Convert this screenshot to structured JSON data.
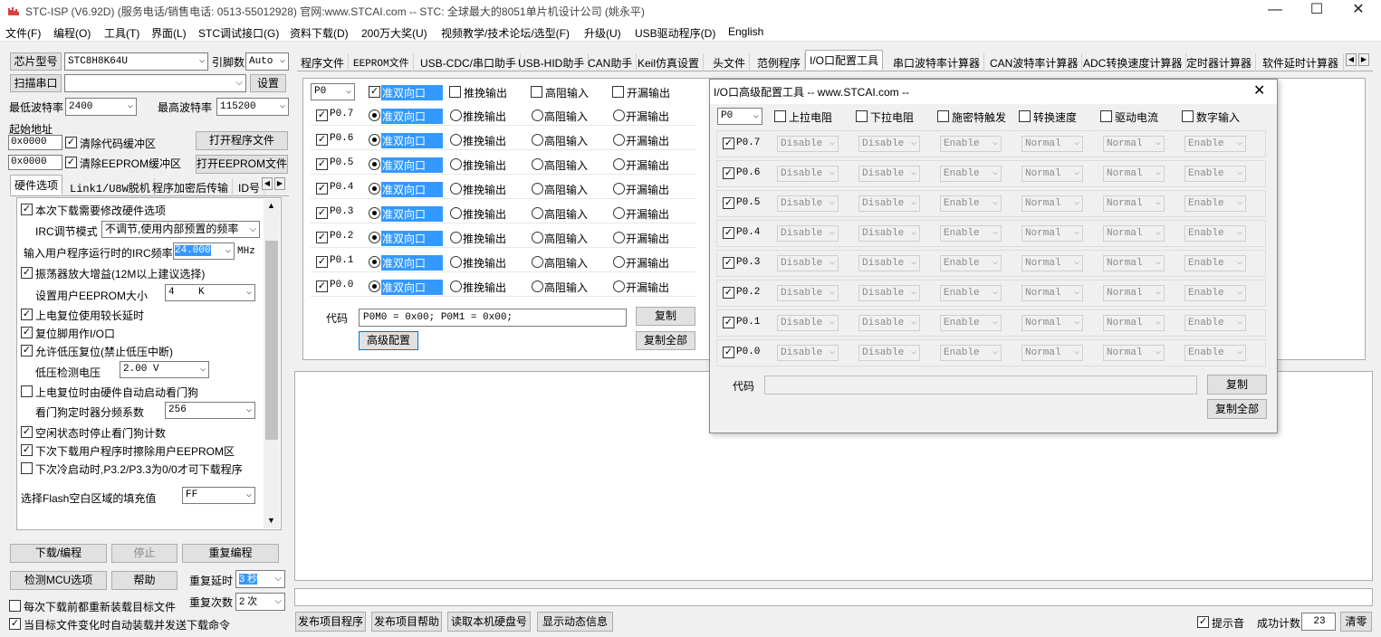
{
  "window": {
    "title": "STC-ISP (V6.92D) (服务电话/销售电话: 0513-55012928) 官网:www.STCAI.com  -- STC: 全球最大的8051单片机设计公司 (姚永平)",
    "min": "—",
    "max": "☐",
    "close": "✕"
  },
  "menu": [
    "文件(F)",
    "编程(O)",
    "工具(T)",
    "界面(L)",
    "STC调试接口(G)",
    "资料下载(D)",
    "200万大奖(U)",
    "视频教学/技术论坛/选型(F)",
    "升级(U)",
    "USB驱动程序(D)",
    "English"
  ],
  "left": {
    "chip_btn": "芯片型号",
    "chip_value": "STC8H8K64U",
    "pins_label": "引脚数",
    "pins_value": "Auto",
    "scan_btn": "扫描串口",
    "port_value": "",
    "settings_btn": "设置",
    "min_baud_label": "最低波特率",
    "min_baud": "2400",
    "max_baud_label": "最高波特率",
    "max_baud": "115200",
    "start_addr_label": "起始地址",
    "addr1": "0x0000",
    "clear_code": "清除代码缓冲区",
    "open_prog": "打开程序文件",
    "addr2": "0x0000",
    "clear_eeprom": "清除EEPROM缓冲区",
    "open_eeprom": "打开EEPROM文件",
    "tabs": [
      "硬件选项",
      "Link1/U8W脱机",
      "程序加密后传输",
      "ID号"
    ],
    "hw": {
      "opt1": "本次下载需要修改硬件选项",
      "irc_mode_label": "IRC调节模式",
      "irc_mode": "不调节,使用内部预置的频率",
      "irc_freq_label": "输入用户程序运行时的IRC频率",
      "irc_freq": "24.000",
      "mhz": "MHz",
      "opt_osc": "振荡器放大增益(12M以上建议选择)",
      "eeprom_size_label": "设置用户EEPROM大小",
      "eeprom_size": "4    K",
      "opt_por": "上电复位使用较长延时",
      "opt_rst_io": "复位脚用作I/O口",
      "opt_lvr": "允许低压复位(禁止低压中断)",
      "lv_label": "低压检测电压",
      "lv_value": "2.00 V",
      "opt_wdt": "上电复位时由硬件自动启动看门狗",
      "wdt_div_label": "看门狗定时器分频系数",
      "wdt_div": "256",
      "opt_idle_wdt": "空闲状态时停止看门狗计数",
      "opt_erase_eeprom": "下次下载用户程序时擦除用户EEPROM区",
      "opt_p32": "下次冷启动时,P3.2/P3.3为0/0才可下载程序",
      "fill_label": "选择Flash空白区域的填充值",
      "fill_value": "FF"
    },
    "download_btn": "下载/编程",
    "stop_btn": "停止",
    "reprog_btn": "重复编程",
    "check_mcu_btn": "检测MCU选项",
    "help_btn": "帮助",
    "repeat_delay_label": "重复延时",
    "repeat_delay": "3 秒",
    "repeat_count_label": "重复次数",
    "repeat_count": "2 次",
    "reload_each": "每次下载前都重新装载目标文件",
    "auto_reload": "当目标文件变化时自动装载并发送下载命令"
  },
  "right_tabs": [
    "程序文件",
    "EEPROM文件",
    "USB-CDC/串口助手",
    "USB-HID助手",
    "CAN助手",
    "Keil仿真设置",
    "头文件",
    "范例程序",
    "I/O口配置工具",
    "串口波特率计算器",
    "CAN波特率计算器",
    "ADC转换速度计算器",
    "定时器计算器",
    "软件延时计算器"
  ],
  "io": {
    "port": "P0",
    "modes": [
      "准双向口",
      "推挽输出",
      "高阻输入",
      "开漏输出"
    ],
    "pins": [
      "P0.7",
      "P0.6",
      "P0.5",
      "P0.4",
      "P0.3",
      "P0.2",
      "P0.1",
      "P0.0"
    ],
    "code_label": "代码",
    "code_value": "P0M0 = 0x00; P0M1 = 0x00;",
    "copy_btn": "复制",
    "adv_btn": "高级配置",
    "copy_all_btn": "复制全部"
  },
  "adv": {
    "title": "I/O口高级配置工具 -- www.STCAI.com --",
    "close": "✕",
    "port": "P0",
    "headers": [
      "上拉电阻",
      "下拉电阻",
      "施密特触发",
      "转换速度",
      "驱动电流",
      "数字输入"
    ],
    "pins": [
      "P0.7",
      "P0.6",
      "P0.5",
      "P0.4",
      "P0.3",
      "P0.2",
      "P0.1",
      "P0.0"
    ],
    "values": [
      "Disable",
      "Disable",
      "Enable",
      "Normal",
      "Normal",
      "Enable"
    ],
    "code_label": "代码",
    "code_value": "",
    "copy_btn": "复制",
    "copy_all_btn": "复制全部"
  },
  "bottom": {
    "publish_prog": "发布项目程序",
    "publish_help": "发布项目帮助",
    "read_disk": "读取本机硬盘号",
    "show_dyn": "显示动态信息",
    "beep": "提示音",
    "success_label": "成功计数",
    "success_count": "23",
    "clear_btn": "清零"
  }
}
